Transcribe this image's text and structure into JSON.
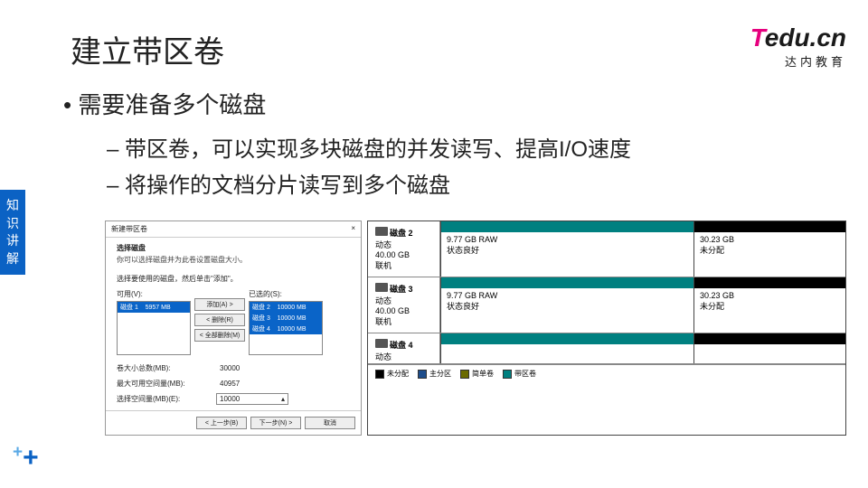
{
  "slide": {
    "title": "建立带区卷",
    "bullet": "需要准备多个磁盘",
    "sub1": "带区卷，可以实现多块磁盘的并发读写、提高I/O速度",
    "sub2": "将操作的文档分片读写到多个磁盘",
    "side_tag": "知识讲解"
  },
  "logo": {
    "t": "T",
    "rest": "edu.cn",
    "sub": "达内教育"
  },
  "dialog": {
    "title": "新建带区卷",
    "close": "×",
    "heading": "选择磁盘",
    "note": "你可以选择磁盘并为此卷设置磁盘大小。",
    "instruction": "选择要使用的磁盘，然后单击\"添加\"。",
    "avail_label": "可用(V):",
    "sel_label": "已选的(S):",
    "avail_items": [
      {
        "name": "磁盘 1",
        "size": "5957 MB"
      }
    ],
    "sel_items": [
      {
        "name": "磁盘 2",
        "size": "10000 MB"
      },
      {
        "name": "磁盘 3",
        "size": "10000 MB"
      },
      {
        "name": "磁盘 4",
        "size": "10000 MB"
      }
    ],
    "btn_add": "添加(A) >",
    "btn_remove": "< 删除(R)",
    "btn_remove_all": "< 全部删除(M)",
    "row_total": {
      "label": "卷大小总数(MB):",
      "value": "30000"
    },
    "row_max": {
      "label": "最大可用空间量(MB):",
      "value": "40957"
    },
    "row_choose": {
      "label": "选择空间量(MB)(E):",
      "value": "10000"
    },
    "prev": "< 上一步(B)",
    "next": "下一步(N) >",
    "cancel": "取消"
  },
  "diskmgr": {
    "disks": [
      {
        "name": "磁盘 2",
        "type": "动态",
        "size": "40.00 GB",
        "status": "联机",
        "p1": {
          "size": "9.77 GB RAW",
          "state": "状态良好"
        },
        "p2": {
          "size": "30.23 GB",
          "state": "未分配"
        }
      },
      {
        "name": "磁盘 3",
        "type": "动态",
        "size": "40.00 GB",
        "status": "联机",
        "p1": {
          "size": "9.77 GB RAW",
          "state": "状态良好"
        },
        "p2": {
          "size": "30.23 GB",
          "state": "未分配"
        }
      },
      {
        "name": "磁盘 4",
        "type": "动态",
        "size": "",
        "status": "",
        "p1": {
          "size": "",
          "state": ""
        },
        "p2": {
          "size": "",
          "state": ""
        }
      }
    ],
    "legend": {
      "unalloc": "未分配",
      "primary": "主分区",
      "simple": "简单卷",
      "striped": "带区卷"
    }
  }
}
